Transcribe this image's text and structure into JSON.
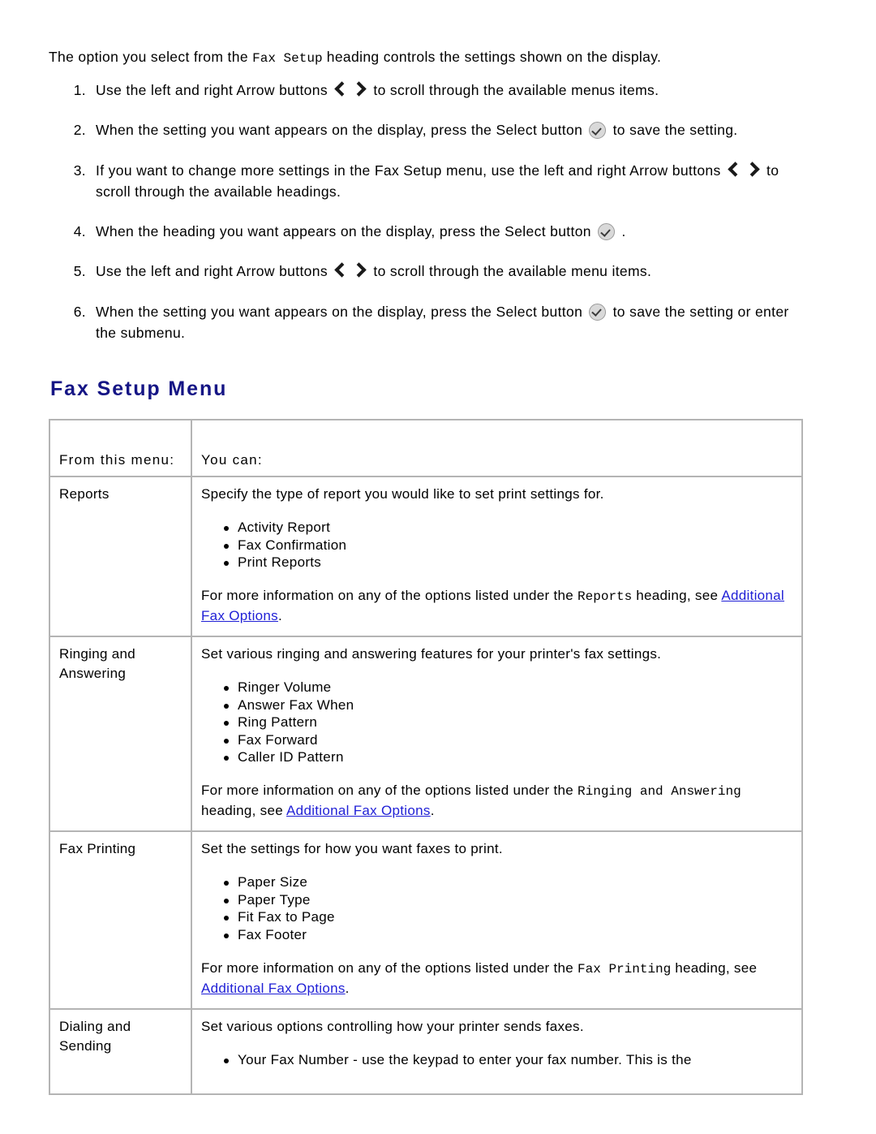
{
  "intro": {
    "before": "The option you select from the ",
    "code": "Fax Setup",
    "after": " heading controls the settings shown on the display."
  },
  "steps": [
    {
      "num": "1.",
      "parts": [
        {
          "t": "text",
          "v": "Use the left and right Arrow buttons "
        },
        {
          "t": "icon",
          "v": "chevron-left-icon"
        },
        {
          "t": "icon",
          "v": "chevron-right-icon"
        },
        {
          "t": "text",
          "v": " to scroll through the available menus items."
        }
      ]
    },
    {
      "num": "2.",
      "parts": [
        {
          "t": "text",
          "v": "When the setting you want appears on the display, press the Select button "
        },
        {
          "t": "icon",
          "v": "select-button-icon"
        },
        {
          "t": "text",
          "v": " to save the setting."
        }
      ]
    },
    {
      "num": "3.",
      "parts": [
        {
          "t": "text",
          "v": "If you want to change more settings in the Fax Setup menu, use the left and right Arrow buttons "
        },
        {
          "t": "icon",
          "v": "chevron-left-icon"
        },
        {
          "t": "icon",
          "v": "chevron-right-icon"
        },
        {
          "t": "text",
          "v": " to scroll through the available headings."
        }
      ]
    },
    {
      "num": "4.",
      "parts": [
        {
          "t": "text",
          "v": "When the heading you want appears on the display, press the Select button "
        },
        {
          "t": "icon",
          "v": "select-button-icon"
        },
        {
          "t": "text",
          "v": " ."
        }
      ]
    },
    {
      "num": "5.",
      "parts": [
        {
          "t": "text",
          "v": "Use the left and right Arrow buttons "
        },
        {
          "t": "icon",
          "v": "chevron-left-icon"
        },
        {
          "t": "icon",
          "v": "chevron-right-icon"
        },
        {
          "t": "text",
          "v": " to scroll through the available menu items."
        }
      ]
    },
    {
      "num": "6.",
      "parts": [
        {
          "t": "text",
          "v": "When the setting you want appears on the display, press the Select button "
        },
        {
          "t": "icon",
          "v": "select-button-icon"
        },
        {
          "t": "text",
          "v": " to save the setting or enter the submenu."
        }
      ]
    }
  ],
  "section": {
    "title": "Fax Setup Menu"
  },
  "table": {
    "headers": [
      "From this menu:",
      "You can:"
    ],
    "rows": [
      {
        "menu": "Reports",
        "lead": "Specify the type of report you would like to set print settings for.",
        "options": [
          "Activity Report",
          "Fax Confirmation",
          "Print Reports"
        ],
        "note_before": "For more information on any of the options listed under the ",
        "note_code": "Reports",
        "note_middle": " heading, see ",
        "note_link": "Additional Fax Options",
        "note_after": "."
      },
      {
        "menu": "Ringing and Answering",
        "lead": "Set various ringing and answering features for your printer's fax settings.",
        "options": [
          "Ringer Volume",
          "Answer Fax When",
          "Ring Pattern",
          "Fax Forward",
          "Caller ID Pattern"
        ],
        "note_before": "For more information on any of the options listed under the ",
        "note_code": "Ringing and Answering",
        "note_middle": " heading, see ",
        "note_link": "Additional Fax Options",
        "note_after": "."
      },
      {
        "menu": "Fax Printing",
        "lead": "Set the settings for how you want faxes to print.",
        "options": [
          "Paper Size",
          "Paper Type",
          "Fit Fax to Page",
          "Fax Footer"
        ],
        "note_before": "For more information on any of the options listed under the ",
        "note_code": "Fax Printing",
        "note_middle": " heading, see ",
        "note_link": "Additional Fax Options",
        "note_after": "."
      },
      {
        "menu": "Dialing and Sending",
        "lead": "Set various options controlling how your printer sends faxes.",
        "options": [
          "Your Fax Number - use the keypad to enter your fax number. This is the"
        ],
        "note_before": "",
        "note_code": "",
        "note_middle": "",
        "note_link": "",
        "note_after": ""
      }
    ]
  },
  "colors": {
    "heading": "#151585",
    "link": "#1f1fd6",
    "table_border": "#b4b4b4"
  }
}
